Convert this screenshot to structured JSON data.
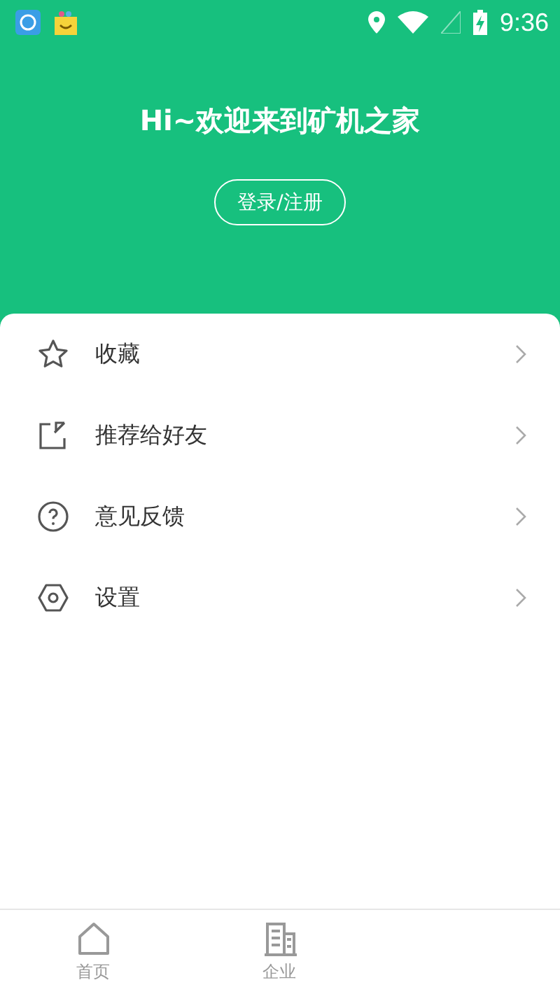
{
  "status_bar": {
    "time": "9:36"
  },
  "header": {
    "greeting": "Hi~欢迎来到矿机之家",
    "login_button": "登录/注册"
  },
  "menu": [
    {
      "kind": "star",
      "label": "收藏"
    },
    {
      "kind": "share",
      "label": "推荐给好友"
    },
    {
      "kind": "help",
      "label": "意见反馈"
    },
    {
      "kind": "settings",
      "label": "设置"
    }
  ],
  "bottom_nav": [
    {
      "kind": "home",
      "label": "首页",
      "selected": false
    },
    {
      "kind": "company",
      "label": "企业",
      "selected": false
    }
  ]
}
